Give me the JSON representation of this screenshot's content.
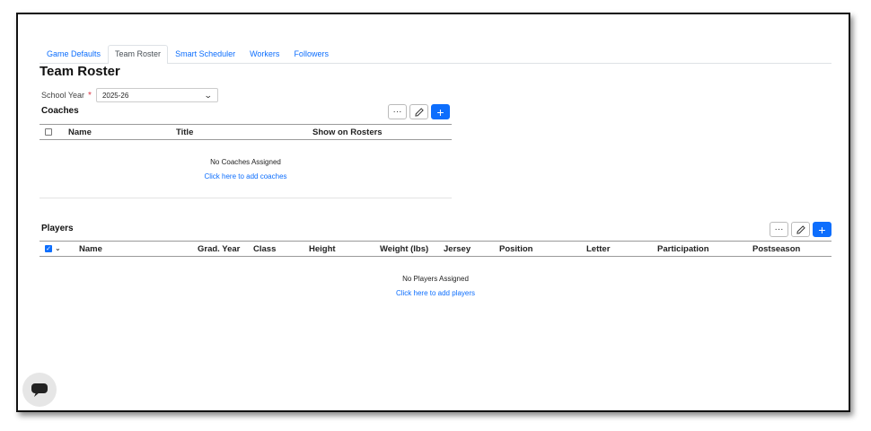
{
  "tabs": [
    {
      "label": "Game Defaults",
      "active": false
    },
    {
      "label": "Team Roster",
      "active": true
    },
    {
      "label": "Smart Scheduler",
      "active": false
    },
    {
      "label": "Workers",
      "active": false
    },
    {
      "label": "Followers",
      "active": false
    }
  ],
  "page_title": "Team Roster",
  "school_year": {
    "label": "School Year",
    "required_mark": "*",
    "value": "2025-26"
  },
  "coaches": {
    "title": "Coaches",
    "columns": [
      "Name",
      "Title",
      "Show on Rosters"
    ],
    "empty_message": "No Coaches Assigned",
    "add_link": "Click here to add coaches"
  },
  "players": {
    "title": "Players",
    "columns": [
      "Name",
      "Grad. Year",
      "Class",
      "Height",
      "Weight (lbs)",
      "Jersey",
      "Position",
      "Letter",
      "Participation",
      "Postseason"
    ],
    "empty_message": "No Players Assigned",
    "add_link": "Click here to add players"
  },
  "toolbar": {
    "more_label": "···",
    "add_label": "+"
  },
  "icons": {
    "more": "ellipsis-icon",
    "edit": "pencil-icon",
    "add": "plus-icon",
    "chat": "chat-icon"
  },
  "colors": {
    "accent": "#0d6efd",
    "required": "#dc3545"
  }
}
